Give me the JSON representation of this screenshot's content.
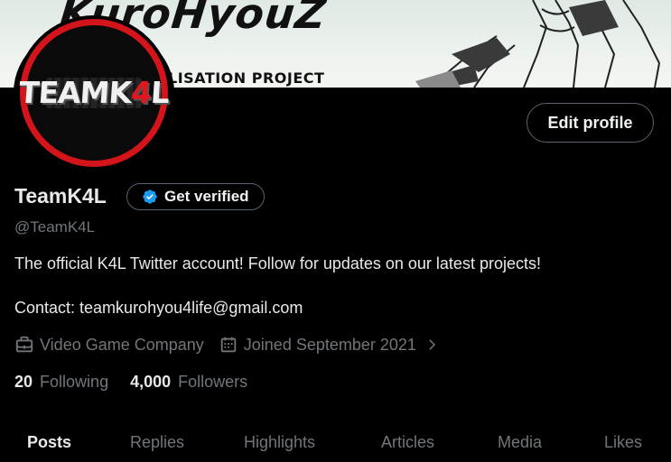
{
  "banner": {
    "title": "KuroHyouZ",
    "subtitle": "LISATION PROJECT"
  },
  "avatar": {
    "logo_main": "TEAMK",
    "logo_accent": "4",
    "logo_end": "L",
    "ring_color": "#d4141b"
  },
  "header": {
    "edit_profile_label": "Edit profile"
  },
  "profile": {
    "name": "TeamK4L",
    "verify_label": "Get verified",
    "handle": "@TeamK4L",
    "bio": "The official K4L Twitter account! Follow for updates on our latest projects!",
    "contact": "Contact: teamkurohyou4life@gmail.com",
    "category": "Video Game Company",
    "joined": "Joined September 2021",
    "following_count": "20",
    "following_label": "Following",
    "followers_count": "4,000",
    "followers_label": "Followers"
  },
  "tabs": [
    {
      "label": "Posts",
      "active": true
    },
    {
      "label": "Replies"
    },
    {
      "label": "Highlights"
    },
    {
      "label": "Articles"
    },
    {
      "label": "Media"
    },
    {
      "label": "Likes"
    }
  ],
  "colors": {
    "accent_blue": "#1d9bf0",
    "muted": "#71767b",
    "text": "#e7e9ea",
    "border": "#536471"
  }
}
